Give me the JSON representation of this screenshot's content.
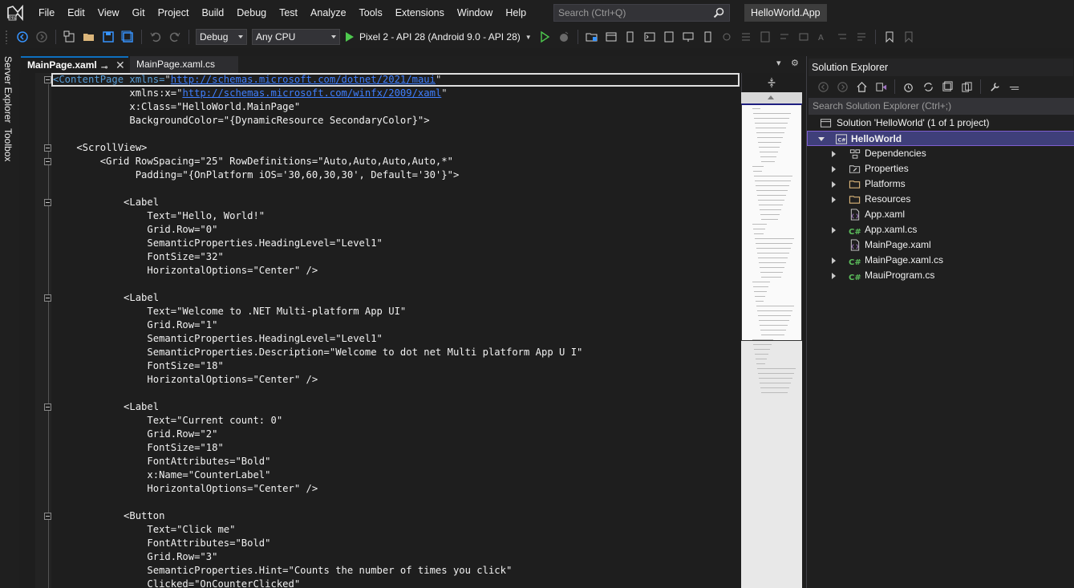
{
  "menubar": {
    "items": [
      "File",
      "Edit",
      "View",
      "Git",
      "Project",
      "Build",
      "Debug",
      "Test",
      "Analyze",
      "Tools",
      "Extensions",
      "Window",
      "Help"
    ],
    "search_placeholder": "Search (Ctrl+Q)",
    "app_title": "HelloWorld.App"
  },
  "toolbar": {
    "config": "Debug",
    "platform": "Any CPU",
    "run_target": "Pixel 2 - API 28 (Android 9.0 - API 28)"
  },
  "left_strip": {
    "server_explorer": "Server Explorer",
    "toolbox": "Toolbox"
  },
  "tabs": [
    {
      "label": "MainPage.xaml",
      "active": true
    },
    {
      "label": "MainPage.xaml.cs",
      "active": false
    }
  ],
  "code_lines": [
    [
      [
        "tag",
        "<ContentPage xmlns="
      ],
      [
        "str",
        "\""
      ],
      [
        "url",
        "http://schemas.microsoft.com/dotnet/2021/maui"
      ],
      [
        "str",
        "\""
      ]
    ],
    [
      [
        "txt",
        "             xmlns:x="
      ],
      [
        "str",
        "\""
      ],
      [
        "url",
        "http://schemas.microsoft.com/winfx/2009/xaml"
      ],
      [
        "str",
        "\""
      ]
    ],
    [
      [
        "txt",
        "             x:Class=\"HelloWorld.MainPage\""
      ]
    ],
    [
      [
        "txt",
        "             BackgroundColor=\"{DynamicResource SecondaryColor}\">"
      ]
    ],
    [
      [
        "txt",
        ""
      ]
    ],
    [
      [
        "txt",
        "    <ScrollView>"
      ]
    ],
    [
      [
        "txt",
        "        <Grid RowSpacing=\"25\" RowDefinitions=\"Auto,Auto,Auto,Auto,*\""
      ]
    ],
    [
      [
        "txt",
        "              Padding=\"{OnPlatform iOS='30,60,30,30', Default='30'}\">"
      ]
    ],
    [
      [
        "txt",
        ""
      ]
    ],
    [
      [
        "txt",
        "            <Label"
      ]
    ],
    [
      [
        "txt",
        "                Text=\"Hello, World!\""
      ]
    ],
    [
      [
        "txt",
        "                Grid.Row=\"0\""
      ]
    ],
    [
      [
        "txt",
        "                SemanticProperties.HeadingLevel=\"Level1\""
      ]
    ],
    [
      [
        "txt",
        "                FontSize=\"32\""
      ]
    ],
    [
      [
        "txt",
        "                HorizontalOptions=\"Center\" />"
      ]
    ],
    [
      [
        "txt",
        ""
      ]
    ],
    [
      [
        "txt",
        "            <Label"
      ]
    ],
    [
      [
        "txt",
        "                Text=\"Welcome to .NET Multi-platform App UI\""
      ]
    ],
    [
      [
        "txt",
        "                Grid.Row=\"1\""
      ]
    ],
    [
      [
        "txt",
        "                SemanticProperties.HeadingLevel=\"Level1\""
      ]
    ],
    [
      [
        "txt",
        "                SemanticProperties.Description=\"Welcome to dot net Multi platform App U I\""
      ]
    ],
    [
      [
        "txt",
        "                FontSize=\"18\""
      ]
    ],
    [
      [
        "txt",
        "                HorizontalOptions=\"Center\" />"
      ]
    ],
    [
      [
        "txt",
        ""
      ]
    ],
    [
      [
        "txt",
        "            <Label"
      ]
    ],
    [
      [
        "txt",
        "                Text=\"Current count: 0\""
      ]
    ],
    [
      [
        "txt",
        "                Grid.Row=\"2\""
      ]
    ],
    [
      [
        "txt",
        "                FontSize=\"18\""
      ]
    ],
    [
      [
        "txt",
        "                FontAttributes=\"Bold\""
      ]
    ],
    [
      [
        "txt",
        "                x:Name=\"CounterLabel\""
      ]
    ],
    [
      [
        "txt",
        "                HorizontalOptions=\"Center\" />"
      ]
    ],
    [
      [
        "txt",
        ""
      ]
    ],
    [
      [
        "txt",
        "            <Button"
      ]
    ],
    [
      [
        "txt",
        "                Text=\"Click me\""
      ]
    ],
    [
      [
        "txt",
        "                FontAttributes=\"Bold\""
      ]
    ],
    [
      [
        "txt",
        "                Grid.Row=\"3\""
      ]
    ],
    [
      [
        "txt",
        "                SemanticProperties.Hint=\"Counts the number of times you click\""
      ]
    ],
    [
      [
        "txt",
        "                Clicked=\"OnCounterClicked\""
      ]
    ]
  ],
  "solution_explorer": {
    "title": "Solution Explorer",
    "search_placeholder": "Search Solution Explorer (Ctrl+;)",
    "solution_label": "Solution 'HelloWorld' (1 of 1 project)",
    "project": "HelloWorld",
    "items": [
      {
        "label": "Dependencies",
        "icon": "dependencies-icon",
        "expandable": true
      },
      {
        "label": "Properties",
        "icon": "properties-icon",
        "expandable": true
      },
      {
        "label": "Platforms",
        "icon": "folder-icon",
        "expandable": true
      },
      {
        "label": "Resources",
        "icon": "folder-icon",
        "expandable": true
      },
      {
        "label": "App.xaml",
        "icon": "xaml-file-icon",
        "expandable": false
      },
      {
        "label": "App.xaml.cs",
        "icon": "csharp-file-icon",
        "expandable": true
      },
      {
        "label": "MainPage.xaml",
        "icon": "xaml-file-icon",
        "expandable": false
      },
      {
        "label": "MainPage.xaml.cs",
        "icon": "csharp-file-icon",
        "expandable": true
      },
      {
        "label": "MauiProgram.cs",
        "icon": "csharp-file-icon",
        "expandable": true
      }
    ]
  },
  "colors": {
    "accent": "#0e70c0",
    "selection": "#3f3f7a",
    "keyword": "#569cd6",
    "link": "#3f7fff",
    "run_green": "#4ec94e"
  }
}
